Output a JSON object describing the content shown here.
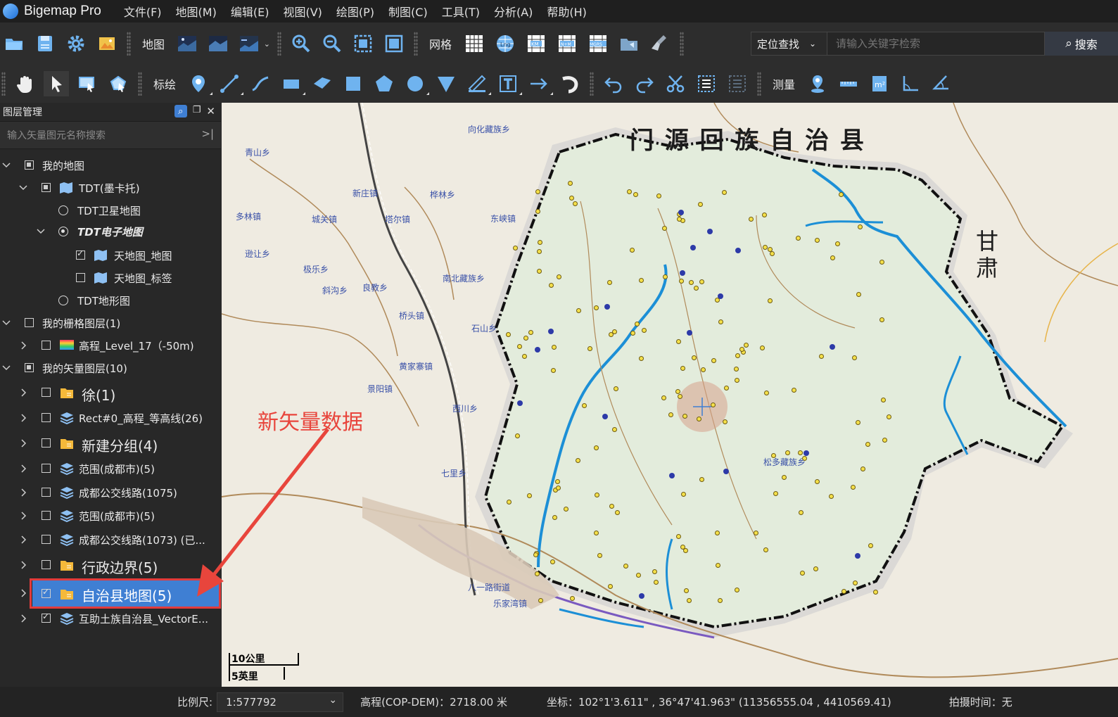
{
  "app": {
    "title": "Bigemap Pro"
  },
  "menu": [
    "文件(F)",
    "地图(M)",
    "编辑(E)",
    "视图(V)",
    "绘图(P)",
    "制图(C)",
    "工具(T)",
    "分析(A)",
    "帮助(H)"
  ],
  "toolbar1": {
    "map_label": "地图",
    "grid_label": "网格",
    "grid_buttons": [
      "Lng",
      "KM",
      "N+M",
      "MGRS"
    ],
    "locate_label": "定位查找",
    "search_placeholder": "请输入关键字检索",
    "search_button": "搜索"
  },
  "toolbar2": {
    "mark_label": "标绘",
    "measure_label": "测量"
  },
  "panel": {
    "title": "图层管理",
    "search_placeholder": "输入矢量图元名称搜索",
    "rows": [
      {
        "label": "我的地图"
      },
      {
        "label": "TDT(墨卡托)"
      },
      {
        "label": "TDT卫星地图"
      },
      {
        "label": "TDT电子地图"
      },
      {
        "label": "天地图_地图"
      },
      {
        "label": "天地图_标签"
      },
      {
        "label": "TDT地形图"
      },
      {
        "label": "我的栅格图层(1)"
      },
      {
        "label": "高程_Level_17（-50m)"
      },
      {
        "label": "我的矢量图层(10)"
      },
      {
        "label": "徐(1)"
      },
      {
        "label": "Rect#0_高程_等高线(26)"
      },
      {
        "label": "新建分组(4)"
      },
      {
        "label": "范围(成都市)(5)"
      },
      {
        "label": "成都公交线路(1075)"
      },
      {
        "label": "范围(成都市)(5)"
      },
      {
        "label": "成都公交线路(1073) (已..."
      },
      {
        "label": "行政边界(5)"
      },
      {
        "label": "自治县地图(5)"
      },
      {
        "label": "互助土族自治县_VectorE..."
      }
    ]
  },
  "annotation": {
    "text": "新矢量数据",
    "color": "#e8453c"
  },
  "map": {
    "county_title": "门 源 回 族 自 治 县",
    "province_label": "甘\n肃",
    "outer_labels": [
      "青山乡",
      "向化藏族乡",
      "多林镇",
      "新庄镇",
      "桦林乡",
      "逊让乡",
      "城关镇",
      "塔尔镇",
      "东峡镇",
      "极乐乡",
      "斜沟乡",
      "良教乡",
      "南北藏族乡",
      "桥头镇",
      "石山乡",
      "黄家寨镇",
      "景阳镇",
      "西川乡",
      "七里乡",
      "八一路街道",
      "乐家湾镇",
      "松多藏族乡"
    ],
    "scale_km": "10公里",
    "scale_mi": "5英里"
  },
  "status": {
    "scale_label": "比例尺:",
    "scale_value": "1:577792",
    "elevation": "高程(COP-DEM)：2718.00 米",
    "coords": "坐标：102°1'3.611\" , 36°47'41.963\"   (11356555.04 , 4410569.41)",
    "capture_time": "拍摄时间：无"
  },
  "colors": {
    "accent": "#3f7fd3",
    "annotation": "#e8453c",
    "river": "#1c8fd6",
    "boundary": "#111111"
  }
}
